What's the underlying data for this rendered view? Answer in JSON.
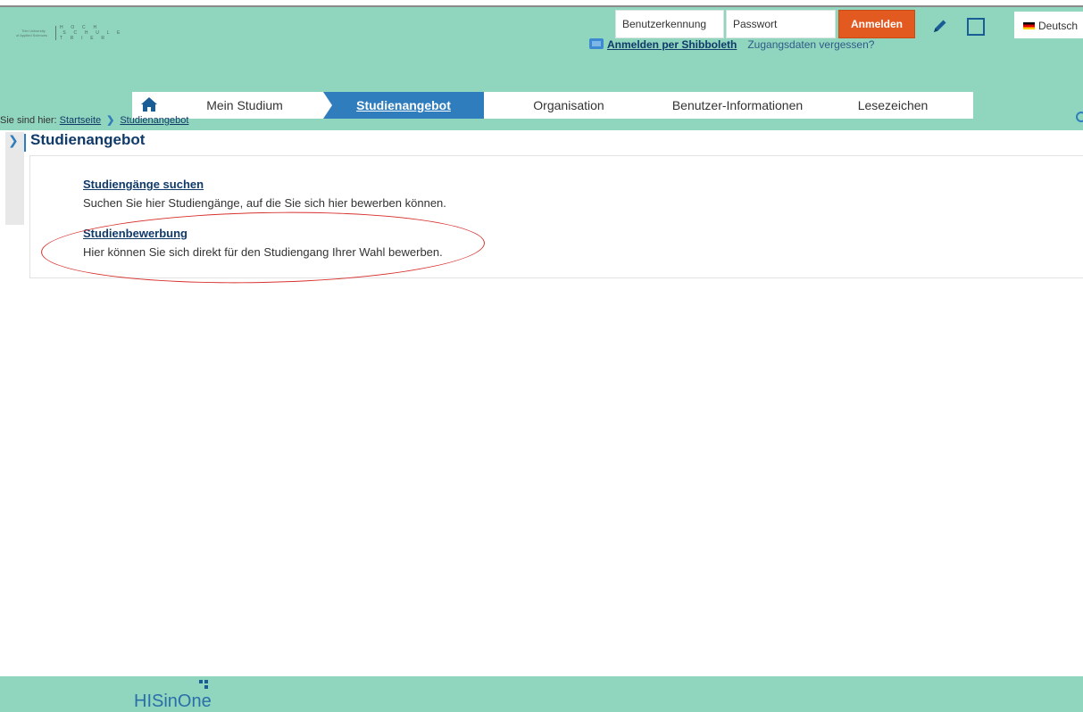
{
  "header": {
    "logo": {
      "sub_line_1": "Trier University",
      "sub_line_2": "of Applied Sciences",
      "word": "H  O  C  H\n S  C  H  U  L  E\nT  R  I  E  R"
    },
    "login": {
      "username_placeholder": "Benutzerkennung",
      "password_placeholder": "Passwort",
      "login_button": "Anmelden",
      "shibboleth_link": "Anmelden per Shibboleth",
      "forgot_link": "Zugangsdaten vergessen?"
    },
    "language": "Deutsch"
  },
  "nav": {
    "items": [
      {
        "label": "Mein Studium"
      },
      {
        "label": "Studienangebot",
        "active": true
      },
      {
        "label": "Organisation"
      },
      {
        "label": "Benutzer-Informationen"
      },
      {
        "label": "Lesezeichen"
      }
    ]
  },
  "breadcrumb": {
    "prefix": "Sie sind hier:",
    "items": [
      "Startseite",
      "Studienangebot"
    ]
  },
  "page": {
    "title": "Studienangebot",
    "entries": [
      {
        "title": "Studiengänge suchen",
        "description": "Suchen Sie hier Studiengänge, auf die Sie sich hier bewerben können."
      },
      {
        "title": "Studienbewerbung",
        "description": "Hier können Sie sich direkt für den Studiengang Ihrer Wahl bewerben."
      }
    ]
  },
  "footer": {
    "brand": "HISinOne"
  },
  "colors": {
    "header_bg": "#90d5bd",
    "accent_blue": "#2f7dbd",
    "login_orange": "#e35a20",
    "annotation_red": "#d8322e"
  }
}
